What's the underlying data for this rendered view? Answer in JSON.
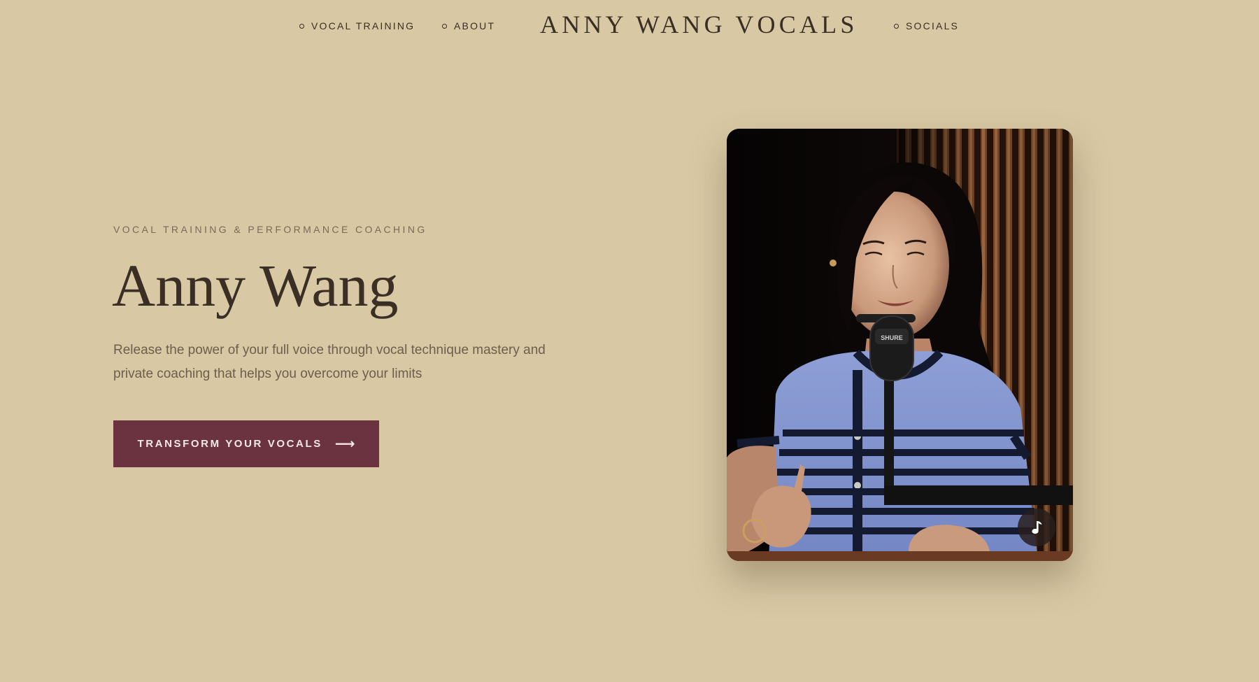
{
  "nav": {
    "left_items": [
      {
        "label": "VOCAL TRAINING"
      },
      {
        "label": "ABOUT"
      }
    ],
    "brand": "ANNY WANG VOCALS",
    "right_items": [
      {
        "label": "SOCIALS"
      }
    ]
  },
  "hero": {
    "eyebrow": "VOCAL TRAINING & PERFORMANCE COACHING",
    "title": "Anny Wang",
    "description": "Release the power of your full voice through vocal technique mastery and private coaching that helps you overcome your limits",
    "cta_label": "TRANSFORM YOUR VOCALS",
    "cta_arrow": "⟶"
  },
  "media": {
    "music_icon": "music-note-icon"
  },
  "colors": {
    "background": "#d8c8a4",
    "text": "#3a2e25",
    "muted_text": "#6d5e4e",
    "accent": "#6b3340"
  }
}
